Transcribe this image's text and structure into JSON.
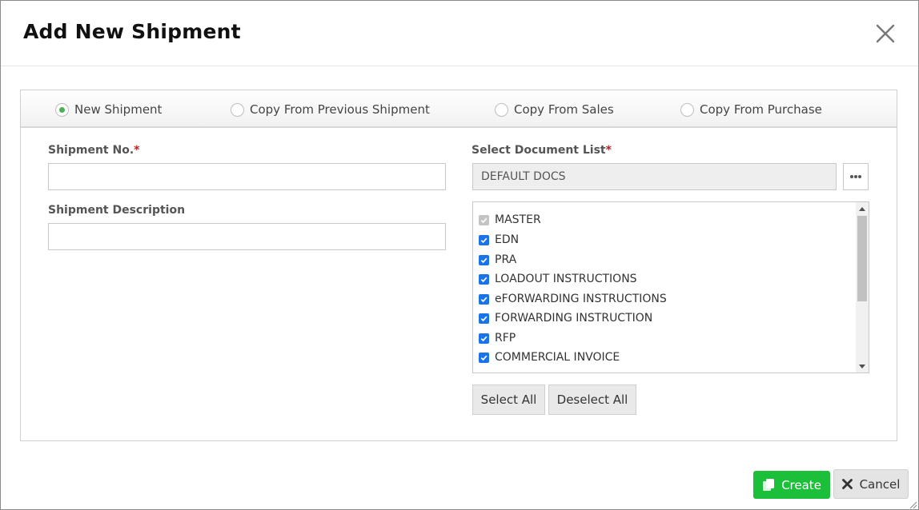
{
  "dialog": {
    "title": "Add New Shipment"
  },
  "shipment_source": {
    "options": [
      {
        "label": "New Shipment",
        "checked": true
      },
      {
        "label": "Copy From Previous Shipment",
        "checked": false
      },
      {
        "label": "Copy From Sales",
        "checked": false
      },
      {
        "label": "Copy From Purchase",
        "checked": false
      }
    ]
  },
  "form": {
    "shipment_no": {
      "label": "Shipment No.",
      "required_mark": "*",
      "value": ""
    },
    "shipment_description": {
      "label": "Shipment Description",
      "value": ""
    },
    "document_list": {
      "label": "Select Document List",
      "required_mark": "*",
      "value": "DEFAULT DOCS"
    }
  },
  "documents": [
    {
      "label": "MASTER",
      "checked": true,
      "disabled": true
    },
    {
      "label": "EDN",
      "checked": true,
      "disabled": false
    },
    {
      "label": "PRA",
      "checked": true,
      "disabled": false
    },
    {
      "label": "LOADOUT INSTRUCTIONS",
      "checked": true,
      "disabled": false
    },
    {
      "label": "eFORWARDING INSTRUCTIONS",
      "checked": true,
      "disabled": false
    },
    {
      "label": "FORWARDING INSTRUCTION",
      "checked": true,
      "disabled": false
    },
    {
      "label": "RFP",
      "checked": true,
      "disabled": false
    },
    {
      "label": "COMMERCIAL INVOICE",
      "checked": true,
      "disabled": false
    }
  ],
  "list_actions": {
    "select_all": "Select All",
    "deselect_all": "Deselect All"
  },
  "footer": {
    "create": "Create",
    "cancel": "Cancel"
  },
  "colors": {
    "accent_green": "#1bbf3a",
    "checkbox_blue": "#1a73e8",
    "required_red": "#b22222"
  },
  "icons": [
    "close-icon",
    "ellipsis-icon",
    "copy-icon",
    "times-icon",
    "scroll-up-icon",
    "scroll-down-icon",
    "resize-grip-icon"
  ]
}
